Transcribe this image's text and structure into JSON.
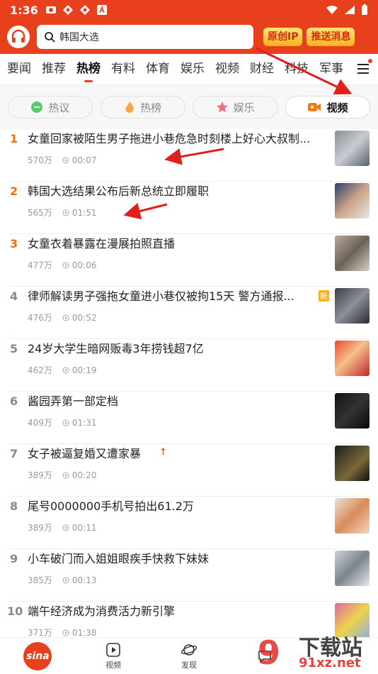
{
  "status_bar": {
    "time": "1:36"
  },
  "header": {
    "search_text": "韩国大选",
    "promo_1": "原创IP",
    "promo_2": "推送消息"
  },
  "nav": {
    "tabs": [
      "要闻",
      "推荐",
      "热榜",
      "有料",
      "体育",
      "娱乐",
      "视频",
      "财经",
      "科技",
      "军事"
    ],
    "active_tab": "热榜"
  },
  "pills": [
    {
      "label": "热议",
      "active": false,
      "icon": "chat-icon"
    },
    {
      "label": "热榜",
      "active": false,
      "icon": "flame-icon"
    },
    {
      "label": "娱乐",
      "active": false,
      "icon": "star-icon"
    },
    {
      "label": "视频",
      "active": true,
      "icon": "video-icon"
    }
  ],
  "list": [
    {
      "rank": "1",
      "title": "女童回家被陌生男子拖进小巷危急时刻楼上好心大叔制...",
      "views": "570万",
      "duration": "00:07"
    },
    {
      "rank": "2",
      "title": "韩国大选结果公布后新总统立即履职",
      "views": "565万",
      "duration": "01:51"
    },
    {
      "rank": "3",
      "title": "女童衣着暴露在漫展拍照直播",
      "views": "477万",
      "duration": "00:06"
    },
    {
      "rank": "4",
      "title": "律师解读男子强拖女童进小巷仅被拘15天 警方通报...",
      "views": "476万",
      "duration": "00:52",
      "badge": "新"
    },
    {
      "rank": "5",
      "title": "24岁大学生暗网贩毒3年捞钱超7亿",
      "views": "462万",
      "duration": "00:19"
    },
    {
      "rank": "6",
      "title": "酱园弄第一部定档",
      "views": "409万",
      "duration": "01:31"
    },
    {
      "rank": "7",
      "title": "女子被逼复婚又遭家暴",
      "views": "389万",
      "duration": "00:20",
      "up": "↑"
    },
    {
      "rank": "8",
      "title": "尾号0000000手机号拍出61.2万",
      "views": "389万",
      "duration": "00:11"
    },
    {
      "rank": "9",
      "title": "小车破门而入姐姐眼疾手快救下妹妹",
      "views": "385万",
      "duration": "00:13"
    },
    {
      "rank": "10",
      "title": "端午经济成为消费活力新引擎",
      "views": "371万",
      "duration": "01:38"
    }
  ],
  "bottom_nav": {
    "home_logo": "sina",
    "video": "视频",
    "discover": "发现"
  },
  "watermark": {
    "text": "下载站",
    "site": "91xz.net"
  },
  "colors": {
    "brand": "#e8401c",
    "rank_top": "#f1700f",
    "promo_gold": "#f7b21d"
  }
}
